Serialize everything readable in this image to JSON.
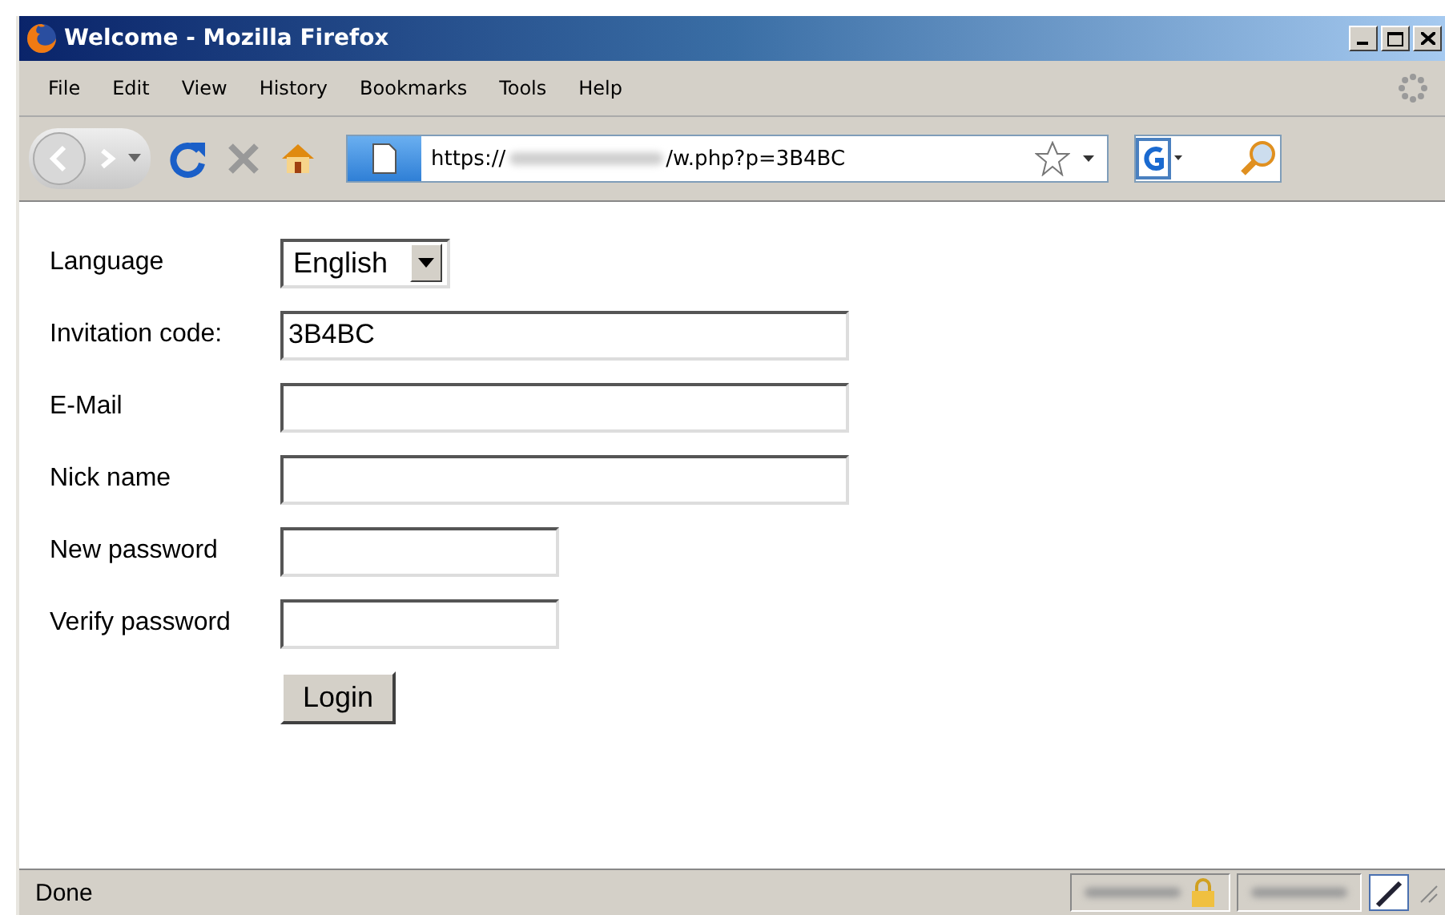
{
  "window": {
    "title": "Welcome - Mozilla Firefox"
  },
  "menu": [
    "File",
    "Edit",
    "View",
    "History",
    "Bookmarks",
    "Tools",
    "Help"
  ],
  "address_bar": {
    "prefix": "https://",
    "suffix": "/w.php?p=3B4BC"
  },
  "form": {
    "fields": [
      {
        "label": "Language",
        "kind": "select",
        "value": "English"
      },
      {
        "label": "Invitation code:",
        "kind": "text",
        "value": "3B4BC"
      },
      {
        "label": "E-Mail",
        "kind": "text"
      },
      {
        "label": "Nick name",
        "kind": "text"
      },
      {
        "label": "New password",
        "kind": "password"
      },
      {
        "label": "Verify password",
        "kind": "password"
      }
    ],
    "submit": "Login"
  },
  "status_bar": {
    "text": "Done"
  }
}
